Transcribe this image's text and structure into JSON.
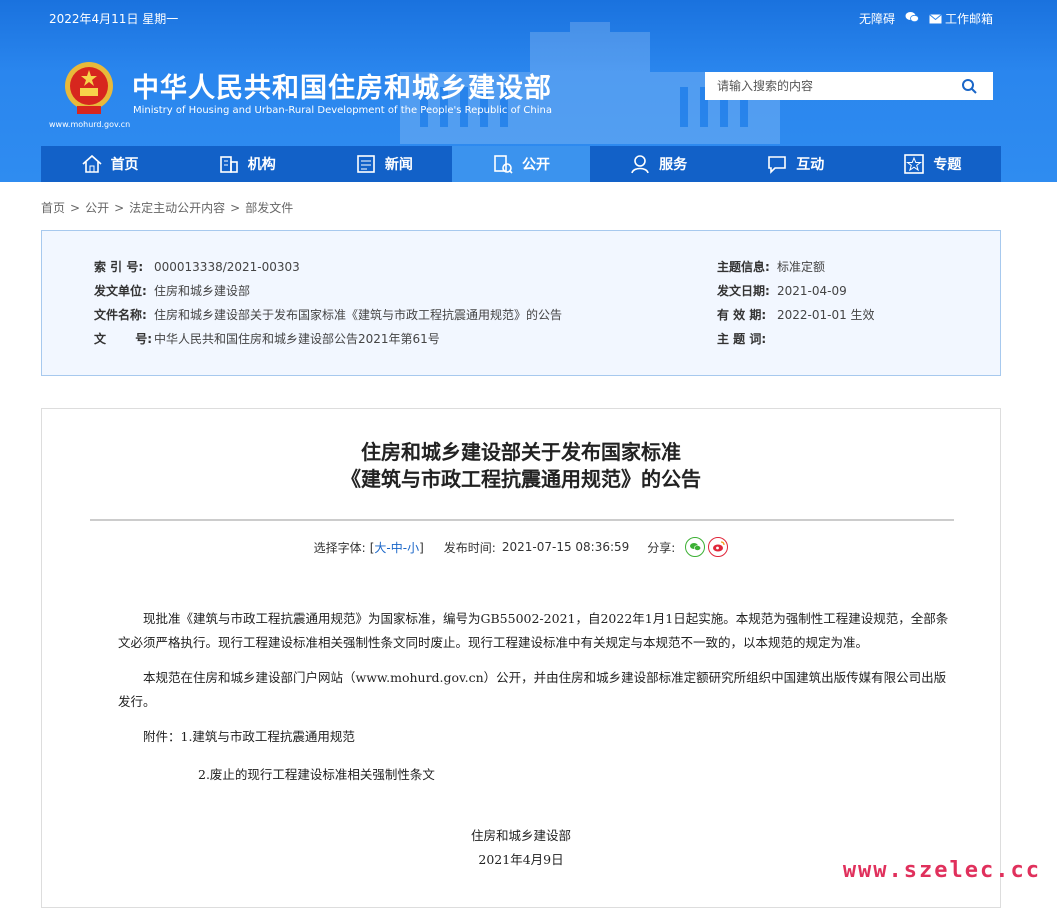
{
  "topbar": {
    "date": "2022年4月11日 星期一",
    "accessibility": "无障碍",
    "mail": "工作邮箱"
  },
  "header": {
    "site_url": "www.mohurd.gov.cn",
    "title": "中华人民共和国住房和城乡建设部",
    "subtitle": "Ministry of Housing and Urban-Rural Development of the People's Republic of China",
    "search_placeholder": "请输入搜索的内容"
  },
  "nav": {
    "items": [
      {
        "label": "首页",
        "icon": "home-icon"
      },
      {
        "label": "机构",
        "icon": "building-icon"
      },
      {
        "label": "新闻",
        "icon": "news-icon"
      },
      {
        "label": "公开",
        "icon": "document-icon",
        "active": true
      },
      {
        "label": "服务",
        "icon": "service-icon"
      },
      {
        "label": "互动",
        "icon": "chat-icon"
      },
      {
        "label": "专题",
        "icon": "star-icon"
      }
    ]
  },
  "breadcrumb": [
    "首页",
    "公开",
    "法定主动公开内容",
    "部发文件"
  ],
  "meta": {
    "index_label": "索 引 号:",
    "index_value": "000013338/2021-00303",
    "unit_label": "发文单位:",
    "unit_value": "住房和城乡建设部",
    "name_label": "文件名称:",
    "name_value": "住房和城乡建设部关于发布国家标准《建筑与市政工程抗震通用规范》的公告",
    "doc_label": "文      号:",
    "doc_value": "中华人民共和国住房和城乡建设部公告2021年第61号",
    "topic_label": "主题信息:",
    "topic_value": "标准定额",
    "date_label": "发文日期:",
    "date_value": "2021-04-09",
    "valid_label": "有 效 期:",
    "valid_value": "2022-01-01 生效",
    "keyword_label": "主 题 词:",
    "keyword_value": ""
  },
  "article": {
    "title_line1": "住房和城乡建设部关于发布国家标准",
    "title_line2": "《建筑与市政工程抗震通用规范》的公告",
    "font_label": "选择字体:",
    "font_open": "[",
    "font_large": "大",
    "font_sep1": "-",
    "font_medium": "中",
    "font_sep2": "-",
    "font_small": "小",
    "font_close": "]",
    "publish_label": "发布时间:",
    "publish_time": "2021-07-15 08:36:59",
    "share_label": "分享:",
    "para1": "现批准《建筑与市政工程抗震通用规范》为国家标准，编号为GB55002-2021，自2022年1月1日起实施。本规范为强制性工程建设规范，全部条文必须严格执行。现行工程建设标准相关强制性条文同时废止。现行工程建设标准中有关规定与本规范不一致的，以本规范的规定为准。",
    "para2": "本规范在住房和城乡建设部门户网站（www.mohurd.gov.cn）公开，并由住房和城乡建设部标准定额研究所组织中国建筑出版传媒有限公司出版发行。",
    "attachment1": "附件：1.建筑与市政工程抗震通用规范",
    "attachment2": "2.废止的现行工程建设标准相关强制性条文",
    "sign_org": "住房和城乡建设部",
    "sign_date": "2021年4月9日"
  },
  "watermark": "www.szelec.cc",
  "colors": {
    "brand_blue": "#2f8cf0",
    "nav_dark": "#1261c8",
    "nav_active": "#3b93ee",
    "meta_bg": "#f2f7ff"
  }
}
